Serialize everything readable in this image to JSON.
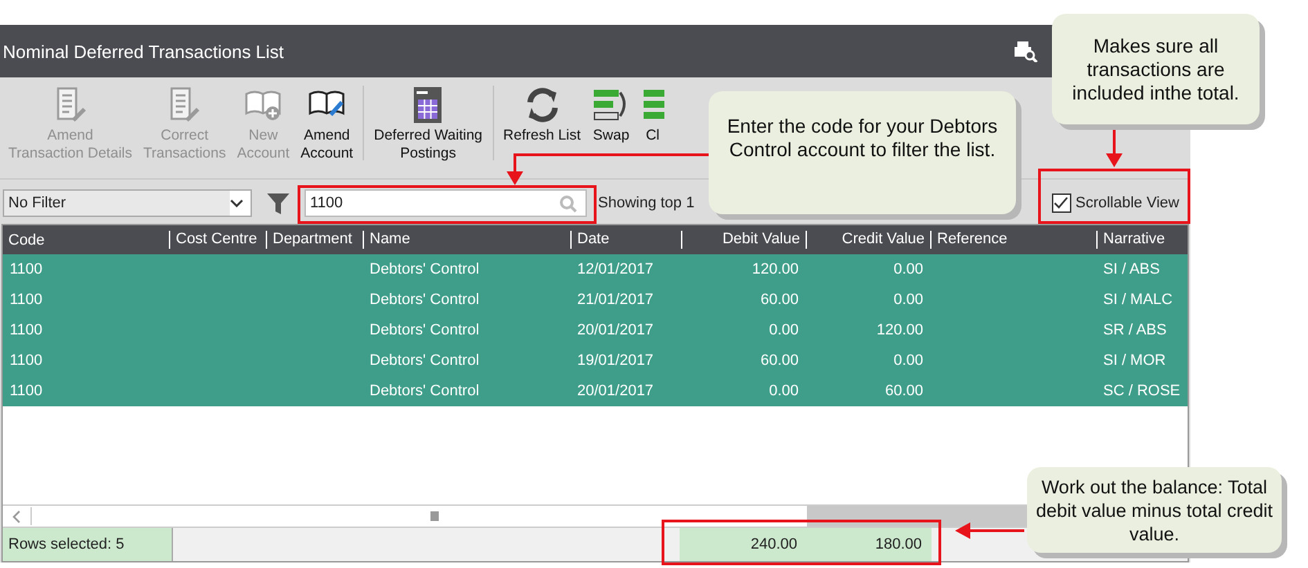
{
  "window": {
    "title": "Nominal Deferred Transactions List"
  },
  "toolbar": [
    {
      "kind": "amend-doc",
      "label": "Amend\nTransaction Details",
      "disabled": true,
      "separator_before": false
    },
    {
      "kind": "correct-doc",
      "label": "Correct\nTransactions",
      "disabled": true,
      "separator_before": false
    },
    {
      "kind": "new-book",
      "label": "New\nAccount",
      "disabled": true,
      "separator_before": false
    },
    {
      "kind": "edit-book",
      "label": "Amend\nAccount",
      "disabled": false,
      "separator_before": false
    },
    {
      "kind": "calendar",
      "label": "Deferred Waiting\nPostings",
      "disabled": false,
      "separator_before": true
    },
    {
      "kind": "refresh",
      "label": "Refresh List",
      "disabled": false,
      "separator_before": true
    },
    {
      "kind": "swap",
      "label": "Swap",
      "disabled": false,
      "separator_before": false
    },
    {
      "kind": "clear",
      "label": "Cl",
      "disabled": false,
      "separator_before": false
    }
  ],
  "filter": {
    "value": "No Filter"
  },
  "search": {
    "value": "1100"
  },
  "showing": "Showing top 1",
  "scrollable_view": {
    "label": "Scrollable View",
    "checked": true
  },
  "table": {
    "columns": [
      "Code",
      "Cost Centre",
      "Department",
      "Name",
      "Date",
      "Debit Value",
      "Credit Value",
      "Reference",
      "Narrative"
    ],
    "rows": [
      {
        "selected": true,
        "cells": [
          "1100",
          "",
          "",
          "Debtors' Control",
          "12/01/2017",
          "120.00",
          "0.00",
          "",
          "SI / ABS"
        ]
      },
      {
        "selected": true,
        "cells": [
          "1100",
          "",
          "",
          "Debtors' Control",
          "21/01/2017",
          "60.00",
          "0.00",
          "",
          "SI / MALC"
        ]
      },
      {
        "selected": true,
        "cells": [
          "1100",
          "",
          "",
          "Debtors' Control",
          "20/01/2017",
          "0.00",
          "120.00",
          "",
          "SR /  ABS"
        ]
      },
      {
        "selected": true,
        "cells": [
          "1100",
          "",
          "",
          "Debtors' Control",
          "19/01/2017",
          "60.00",
          "0.00",
          "",
          "SI / MOR"
        ]
      },
      {
        "selected": true,
        "cells": [
          "1100",
          "",
          "",
          "Debtors' Control",
          "20/01/2017",
          "0.00",
          "60.00",
          "",
          "SC / ROSE"
        ]
      }
    ]
  },
  "status_bar": {
    "rows_selected": "Rows selected: 5",
    "debit_total": "240.00",
    "credit_total": "180.00"
  },
  "callouts": [
    {
      "text": "Enter the code for your Debtors Control account to filter the list."
    },
    {
      "text": "Makes sure all transactions are included inthe total."
    },
    {
      "text": "Work out the balance: Total debit value minus total credit value."
    }
  ]
}
